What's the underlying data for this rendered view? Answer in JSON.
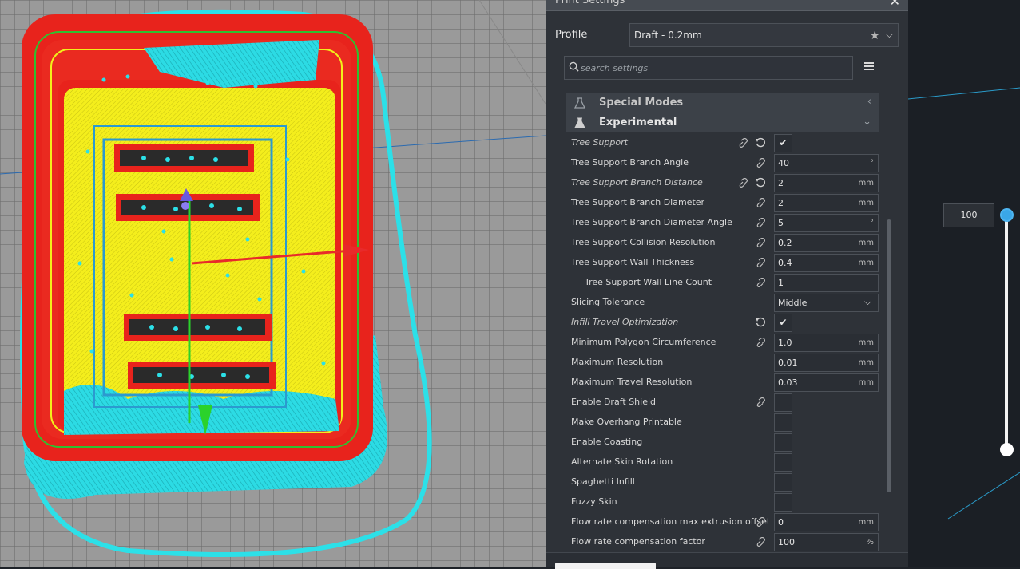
{
  "panel": {
    "title": "Print Settings",
    "close_glyph": "✕",
    "profile_label": "Profile",
    "profile_value": "Draft - 0.2mm",
    "search_placeholder": "search settings",
    "categories": [
      {
        "label": "Special Modes",
        "icon": "flask-outline-icon",
        "chevron": "‹"
      },
      {
        "label": "Experimental",
        "icon": "flask-icon",
        "chevron": "⌄"
      }
    ],
    "rows": [
      {
        "label": "Tree Support",
        "checked": "✔"
      },
      {
        "label": "Tree Support Branch Angle",
        "value": "40",
        "unit": "°"
      },
      {
        "label": "Tree Support Branch Distance",
        "value": "2",
        "unit": "mm"
      },
      {
        "label": "Tree Support Branch Diameter",
        "value": "2",
        "unit": "mm"
      },
      {
        "label": "Tree Support Branch Diameter Angle",
        "value": "5",
        "unit": "°"
      },
      {
        "label": "Tree Support Collision Resolution",
        "value": "0.2",
        "unit": "mm"
      },
      {
        "label": "Tree Support Wall Thickness",
        "value": "0.4",
        "unit": "mm"
      },
      {
        "label": "Tree Support Wall Line Count",
        "value": "1"
      },
      {
        "label": "Slicing Tolerance",
        "value": "Middle"
      },
      {
        "label": "Infill Travel Optimization",
        "checked": "✔"
      },
      {
        "label": "Minimum Polygon Circumference",
        "value": "1.0",
        "unit": "mm"
      },
      {
        "label": "Maximum Resolution",
        "value": "0.01",
        "unit": "mm"
      },
      {
        "label": "Maximum Travel Resolution",
        "value": "0.03",
        "unit": "mm"
      },
      {
        "label": "Enable Draft Shield"
      },
      {
        "label": "Make Overhang Printable"
      },
      {
        "label": "Enable Coasting"
      },
      {
        "label": "Alternate Skin Rotation"
      },
      {
        "label": "Spaghetti Infill"
      },
      {
        "label": "Fuzzy Skin"
      },
      {
        "label": "Flow rate compensation max extrusion offset",
        "value": "0",
        "unit": "mm"
      },
      {
        "label": "Flow rate compensation factor",
        "value": "100",
        "unit": "%"
      }
    ]
  },
  "layer_slider": {
    "value": "100"
  },
  "colors": {
    "panel_bg": "#2e3238",
    "wall_red": "#e8231c",
    "infill_yellow": "#f2f01a",
    "support_cyan": "#2ce0e8",
    "slider_blue": "#3aa7e8"
  }
}
